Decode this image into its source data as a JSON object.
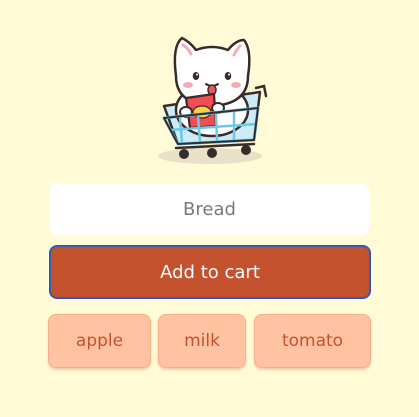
{
  "mascot": {
    "icon": "cat-in-shopping-cart-icon",
    "colors": {
      "cat_fill": "#ffffff",
      "outline": "#3a2b2b",
      "cheek": "#f7a9b1",
      "cart": "#6cc8e6",
      "cart_bag": "#f14d55",
      "bag_label": "#ffd23b"
    }
  },
  "form": {
    "item_input": {
      "value": "",
      "placeholder": "Bread"
    },
    "add_button_label": "Add to cart"
  },
  "suggestions": [
    {
      "label": "apple"
    },
    {
      "label": "milk"
    },
    {
      "label": "tomato"
    }
  ],
  "colors": {
    "background": "#fffbd6",
    "primary": "#c5522e",
    "focus_ring": "#2f5bb6",
    "chip_background": "#ffc3a1"
  }
}
